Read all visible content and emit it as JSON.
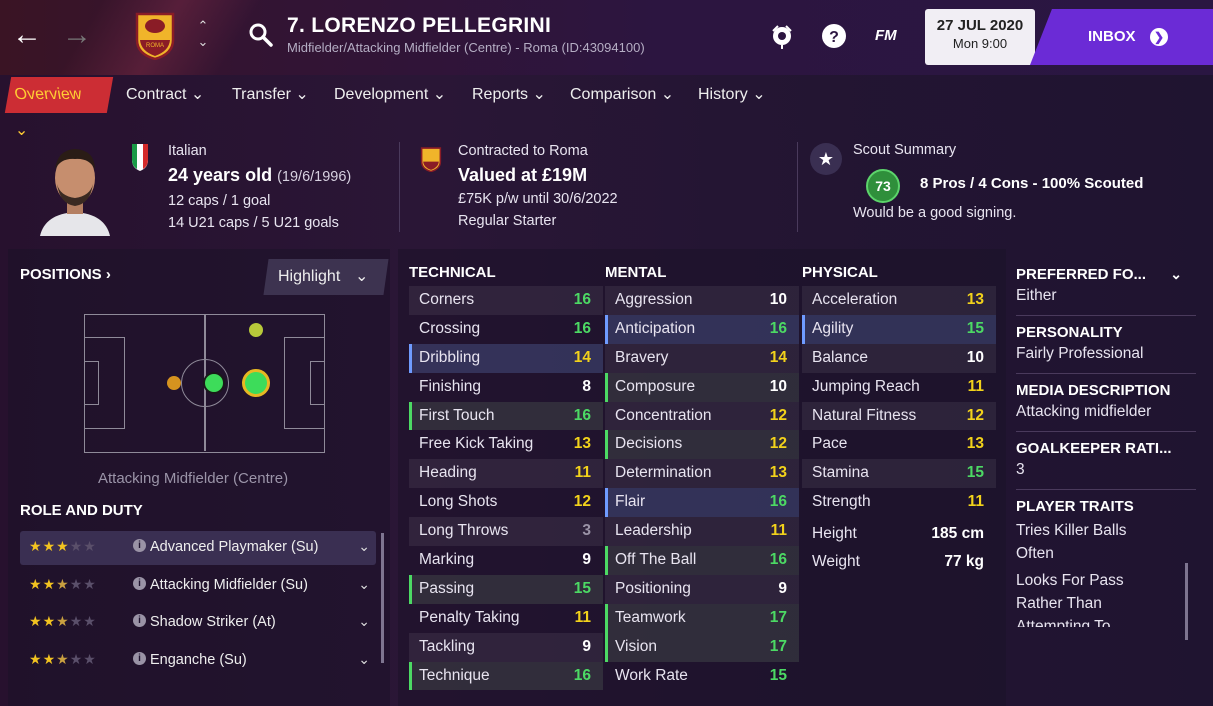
{
  "header": {
    "player_name": "7. LORENZO PELLEGRINI",
    "subtitle": "Midfielder/Attacking Midfielder (Centre) - Roma (ID:43094100)",
    "fm_label": "FM",
    "date": "27 JUL 2020",
    "time": "Mon 9:00",
    "inbox_label": "INBOX",
    "crest_text": "ROMA"
  },
  "tabs": [
    {
      "label": "Overview"
    },
    {
      "label": "Contract"
    },
    {
      "label": "Transfer"
    },
    {
      "label": "Development"
    },
    {
      "label": "Reports"
    },
    {
      "label": "Comparison"
    },
    {
      "label": "History"
    }
  ],
  "bio": {
    "nationality": "Italian",
    "age": "24 years old",
    "dob": "(19/6/1996)",
    "caps": "12 caps / 1 goal",
    "u21": "14 U21 caps / 5 U21 goals"
  },
  "contract": {
    "club": "Contracted to Roma",
    "value": "Valued at £19M",
    "wage": "£75K p/w until 30/6/2022",
    "status": "Regular Starter"
  },
  "scout": {
    "title": "Scout Summary",
    "rating": "73",
    "summary": "8 Pros / 4 Cons - 100% Scouted",
    "verdict": "Would be a good signing."
  },
  "positions": {
    "title": "POSITIONS",
    "highlight_label": "Highlight",
    "position_label": "Attacking Midfielder (Centre)"
  },
  "roles": {
    "title": "ROLE AND DUTY",
    "items": [
      {
        "name": "Advanced Playmaker (Su)",
        "stars": 3
      },
      {
        "name": "Attacking Midfielder (Su)",
        "stars": 2.5
      },
      {
        "name": "Shadow Striker (At)",
        "stars": 2.5
      },
      {
        "name": "Enganche (Su)",
        "stars": 2.5
      }
    ]
  },
  "technical": {
    "title": "TECHNICAL",
    "rows": [
      {
        "name": "Corners",
        "value": "16"
      },
      {
        "name": "Crossing",
        "value": "16"
      },
      {
        "name": "Dribbling",
        "value": "14"
      },
      {
        "name": "Finishing",
        "value": "8"
      },
      {
        "name": "First Touch",
        "value": "16"
      },
      {
        "name": "Free Kick Taking",
        "value": "13"
      },
      {
        "name": "Heading",
        "value": "11"
      },
      {
        "name": "Long Shots",
        "value": "12"
      },
      {
        "name": "Long Throws",
        "value": "3"
      },
      {
        "name": "Marking",
        "value": "9"
      },
      {
        "name": "Passing",
        "value": "15"
      },
      {
        "name": "Penalty Taking",
        "value": "11"
      },
      {
        "name": "Tackling",
        "value": "9"
      },
      {
        "name": "Technique",
        "value": "16"
      }
    ]
  },
  "mental": {
    "title": "MENTAL",
    "rows": [
      {
        "name": "Aggression",
        "value": "10"
      },
      {
        "name": "Anticipation",
        "value": "16"
      },
      {
        "name": "Bravery",
        "value": "14"
      },
      {
        "name": "Composure",
        "value": "10"
      },
      {
        "name": "Concentration",
        "value": "12"
      },
      {
        "name": "Decisions",
        "value": "12"
      },
      {
        "name": "Determination",
        "value": "13"
      },
      {
        "name": "Flair",
        "value": "16"
      },
      {
        "name": "Leadership",
        "value": "11"
      },
      {
        "name": "Off The Ball",
        "value": "16"
      },
      {
        "name": "Positioning",
        "value": "9"
      },
      {
        "name": "Teamwork",
        "value": "17"
      },
      {
        "name": "Vision",
        "value": "17"
      },
      {
        "name": "Work Rate",
        "value": "15"
      }
    ]
  },
  "physical": {
    "title": "PHYSICAL",
    "rows": [
      {
        "name": "Acceleration",
        "value": "13"
      },
      {
        "name": "Agility",
        "value": "15"
      },
      {
        "name": "Balance",
        "value": "10"
      },
      {
        "name": "Jumping Reach",
        "value": "11"
      },
      {
        "name": "Natural Fitness",
        "value": "12"
      },
      {
        "name": "Pace",
        "value": "13"
      },
      {
        "name": "Stamina",
        "value": "15"
      },
      {
        "name": "Strength",
        "value": "11"
      }
    ],
    "height_label": "Height",
    "height": "185 cm",
    "weight_label": "Weight",
    "weight": "77 kg"
  },
  "side": {
    "pref_foot_title": "PREFERRED FO...",
    "pref_foot": "Either",
    "personality_title": "PERSONALITY",
    "personality": "Fairly Professional",
    "media_title": "MEDIA DESCRIPTION",
    "media": "Attacking midfielder",
    "gk_title": "GOALKEEPER RATI...",
    "gk": "3",
    "traits_title": "PLAYER TRAITS",
    "traits": [
      "Tries Killer Balls Often",
      "Looks For Pass Rather Than Attempting To"
    ]
  },
  "colors": {
    "accent": "#6b2bd6",
    "tab_active": "#cc2d34",
    "value_green": "#4cd964",
    "value_yellow": "#f2d21b",
    "value_white": "#ffffff",
    "value_grey": "#9a93a6"
  }
}
